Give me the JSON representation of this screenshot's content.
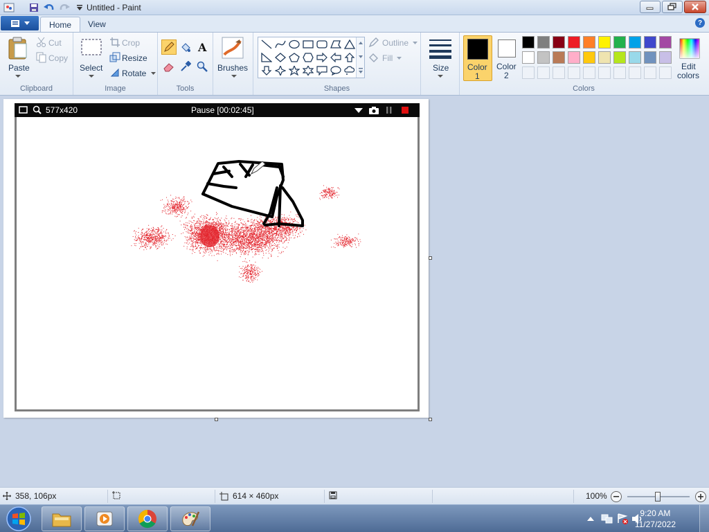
{
  "window": {
    "title": "Untitled - Paint"
  },
  "tabs": [
    {
      "label": "Home"
    },
    {
      "label": "View"
    }
  ],
  "clipboard": {
    "paste": "Paste",
    "cut": "Cut",
    "copy": "Copy",
    "group": "Clipboard"
  },
  "image": {
    "select": "Select",
    "crop": "Crop",
    "resize": "Resize",
    "rotate": "Rotate",
    "group": "Image"
  },
  "tools": {
    "group": "Tools"
  },
  "brushes": {
    "label": "Brushes"
  },
  "shapes": {
    "outline": "Outline",
    "fill": "Fill",
    "group": "Shapes"
  },
  "size": {
    "label": "Size"
  },
  "colors": {
    "color1_line1": "Color",
    "color1_line2": "1",
    "color2_line1": "Color",
    "color2_line2": "2",
    "edit_line1": "Edit",
    "edit_line2": "colors",
    "group": "Colors",
    "color1": "#000000",
    "color2": "#ffffff",
    "palette_row1": [
      "#000000",
      "#7f7f7f",
      "#880015",
      "#ed1c24",
      "#ff7f27",
      "#fff200",
      "#22b14c",
      "#00a2e8",
      "#3f48cc",
      "#a349a4"
    ],
    "palette_row2": [
      "#ffffff",
      "#c3c3c3",
      "#b97a57",
      "#ffaec9",
      "#ffc90e",
      "#efe4b0",
      "#b5e61d",
      "#99d9ea",
      "#7092be",
      "#c8bfe7"
    ]
  },
  "recorder": {
    "resolution": "577x420",
    "status": "Pause [00:02:45]"
  },
  "status": {
    "cursor": "358, 106px",
    "canvas_size": "614 × 460px",
    "zoom": "100%"
  },
  "taskbar": {
    "time": "9:20 AM",
    "date": "11/27/2022"
  }
}
